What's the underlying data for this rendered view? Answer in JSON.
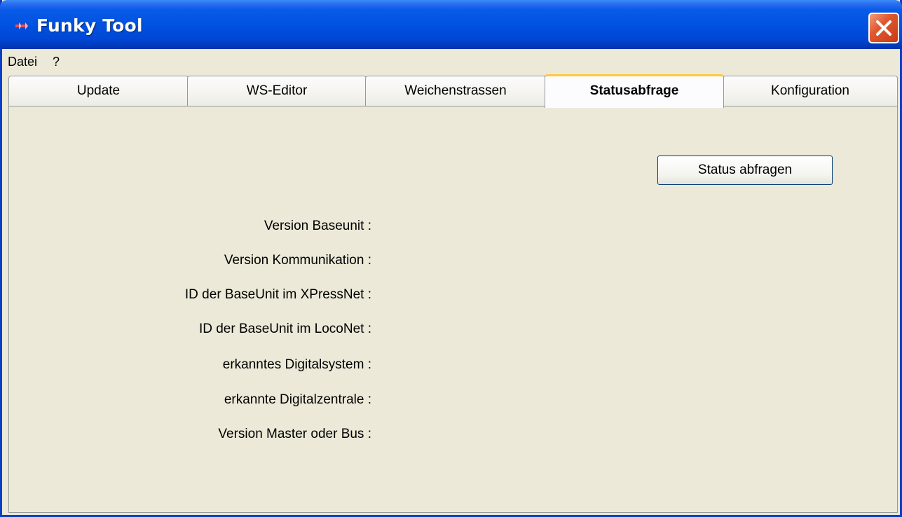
{
  "window": {
    "title": "Funky Tool",
    "icon": "app-icon",
    "close_icon": "close-icon"
  },
  "menu": {
    "items": [
      "Datei",
      "?"
    ]
  },
  "tabs": [
    {
      "label": "Update",
      "active": false
    },
    {
      "label": "WS-Editor",
      "active": false
    },
    {
      "label": "Weichenstrassen",
      "active": false
    },
    {
      "label": "Statusabfrage",
      "active": true
    },
    {
      "label": "Konfiguration",
      "active": false
    }
  ],
  "status_panel": {
    "button_label": "Status abfragen",
    "fields": [
      {
        "label": "Version Baseunit :",
        "value": ""
      },
      {
        "label": "Version Kommunikation :",
        "value": ""
      },
      {
        "label": "ID der BaseUnit im XPressNet :",
        "value": ""
      },
      {
        "label": "ID der BaseUnit im LocoNet :",
        "value": ""
      },
      {
        "label": "erkanntes Digitalsystem :",
        "value": ""
      },
      {
        "label": "erkannte Digitalzentrale :",
        "value": ""
      },
      {
        "label": "Version Master oder Bus :",
        "value": ""
      }
    ]
  },
  "colors": {
    "titlebar": "#0052e0",
    "window_bg": "#ece9d8",
    "active_tab_accent": "#ffc83c",
    "close_button": "#e0582e"
  }
}
